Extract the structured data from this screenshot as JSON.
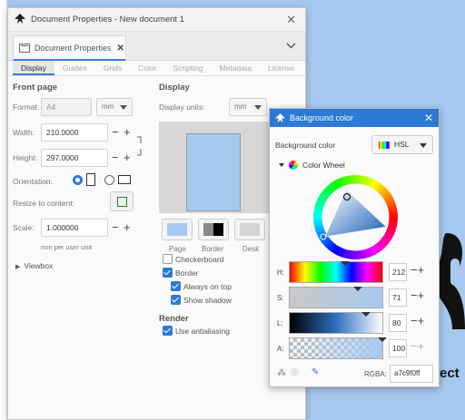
{
  "app": {
    "window_title": "Document Properties - New document 1",
    "doc_tab": "Document Properties",
    "subtabs": [
      "Display",
      "Guides",
      "Grids",
      "Color",
      "Scripting",
      "Metadata",
      "License"
    ]
  },
  "front_page": {
    "heading": "Front page",
    "format_label": "Format:",
    "format_value": "A4",
    "unit_value": "mm",
    "width_label": "Width:",
    "width_value": "210.0000",
    "height_label": "Height:",
    "height_value": "297.0000",
    "orientation_label": "Orientation:",
    "resize_label": "Resize to content:",
    "scale_label": "Scale:",
    "scale_value": "1.000000",
    "scale_unit_note": "mm per user unit",
    "viewbox_label": "Viewbox"
  },
  "display": {
    "heading": "Display",
    "units_label": "Display units:",
    "units_value": "mm",
    "swatches": [
      "Page",
      "Border",
      "Desk"
    ],
    "checkboxes": [
      {
        "label": "Checkerboard",
        "checked": false
      },
      {
        "label": "Border",
        "checked": true
      },
      {
        "label": "Always on top",
        "checked": true
      },
      {
        "label": "Show shadow",
        "checked": true
      }
    ],
    "render_heading": "Render",
    "antialias_label": "Use antialiasing",
    "antialias_checked": true
  },
  "color_dialog": {
    "title": "Background color",
    "label": "Background color",
    "mode": "HSL",
    "wheel_label": "Color Wheel",
    "sliders": [
      {
        "label": "H:",
        "value": "212"
      },
      {
        "label": "S:",
        "value": "71"
      },
      {
        "label": "L:",
        "value": "80"
      },
      {
        "label": "A:",
        "value": "100"
      }
    ],
    "rgba_label": "RGBA:",
    "rgba_value": "a7c9f0ff"
  },
  "canvas": {
    "text_fragment": "ect"
  },
  "colors": {
    "accent": "#2d7ad6",
    "page_color": "#a7c9f0"
  }
}
